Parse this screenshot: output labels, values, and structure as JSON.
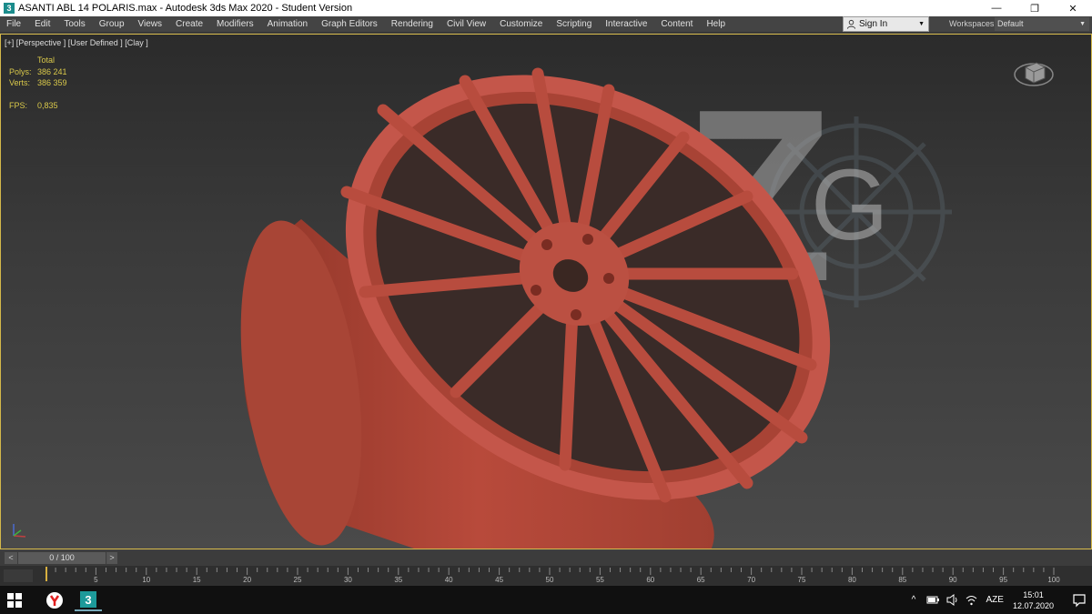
{
  "window": {
    "title": "ASANTI ABL 14 POLARIS.max - Autodesk 3ds Max 2020 - Student Version",
    "app_icon_text": "3",
    "minimize": "—",
    "maximize": "❐",
    "close": "✕"
  },
  "menu": [
    "File",
    "Edit",
    "Tools",
    "Group",
    "Views",
    "Create",
    "Modifiers",
    "Animation",
    "Graph Editors",
    "Rendering",
    "Civil View",
    "Customize",
    "Scripting",
    "Interactive",
    "Content",
    "Help"
  ],
  "signin": {
    "label": "Sign In"
  },
  "workspaces": {
    "label": "Workspaces:",
    "value": "Default"
  },
  "viewport": {
    "label": "[+] [Perspective ] [User Defined ] [Clay ]",
    "stats": {
      "header": "Total",
      "polys_label": "Polys:",
      "polys_value": "386 241",
      "verts_label": "Verts:",
      "verts_value": "386 359",
      "fps_label": "FPS:",
      "fps_value": "0,835"
    },
    "watermark": {
      "z": "Z",
      "g": "G"
    },
    "model_color": "#b34a38"
  },
  "timeline": {
    "prev": "<",
    "frame": "0 / 100",
    "next": ">",
    "ticks": [
      "5",
      "10",
      "15",
      "20",
      "25",
      "30",
      "35",
      "40",
      "45",
      "50",
      "55",
      "60",
      "65",
      "70",
      "75",
      "80",
      "85",
      "90",
      "95",
      "100"
    ]
  },
  "taskbar": {
    "language": "AZE",
    "time": "15:01",
    "date": "12.07.2020"
  }
}
